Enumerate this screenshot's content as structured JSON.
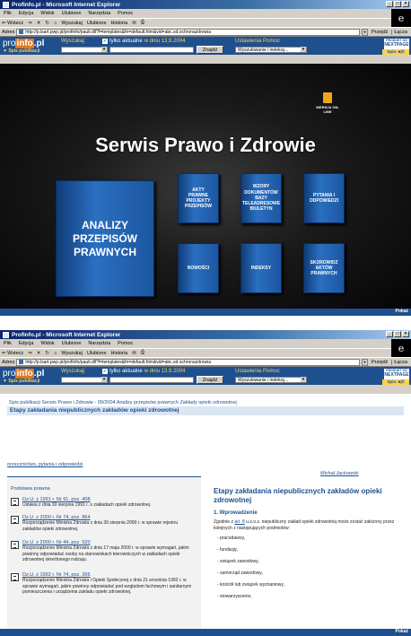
{
  "window": {
    "title": "Profinfo.pl - Microsoft Internet Explorer",
    "title2": "Profinfo.pl - Microsoft Internet Explorer",
    "controls": [
      "_",
      "□",
      "×"
    ]
  },
  "menu": [
    "Plik",
    "Edycja",
    "Widok",
    "Ulubione",
    "Narzędzia",
    "Pomoc"
  ],
  "toolbar": {
    "back": "⇐ Wstecz",
    "forward": "⇒",
    "stop": "✕",
    "refresh": "↻",
    "home": "⌂",
    "search": "Wyszukaj",
    "favorites": "Ulubione",
    "history": "Historia",
    "mail": "✉",
    "print": "⎙"
  },
  "address": {
    "label": "Adres",
    "url1": "http://p.lsart.pwp.pl/profinfo/pauti.dll?f=templates&fn=default.htm&vid=abc.sd.ochronazdrowia",
    "url2": "http://p.lsart.pwp.pl/profinfo/pauti.dll?f=templates&fn=default.htm&vid=abc.sd.ochronazdrowia",
    "go": "Przejdź",
    "links": "Łącza"
  },
  "site": {
    "logo_pro": "pro",
    "logo_info": "info",
    "logo_pl": ".pl",
    "search_label": "Wyszukaj:",
    "only_current": "tylko aktualne",
    "date_label": "w dniu 13.9.2004",
    "links": "Ustawienia  Pomoc",
    "select1": "",
    "search_btn": "Znajdź",
    "select2": "Wyszukiwanie i indeksy...",
    "spis_left": "▼ Spis publikacji",
    "brand_top": "PRODUKT OD",
    "brand_name": "NEXTPAGE",
    "spis_right": "Spis: ■|Ⅹ"
  },
  "screen1": {
    "wersja": "WERSJA ON-LINE",
    "main_title": "Serwis Prawo i Zdrowie",
    "big_book": "ANALIZY\nPRZEPISÓW\nPRAWNYCH",
    "books": [
      "AKTY\nPRAWNE\nPROJEKTY\nPRZEPISÓW",
      "WZORY\nDOKUMENTÓW\nBAZY\nTELEADRESOWE\nBIULETYN",
      "PYTANIA I\nODPOWIEDZI",
      "NOWOŚCI",
      "INDEKSY",
      "SKOROWIDZ\nAKTÓW\nPRAWNYCH"
    ],
    "status": "Pokaż"
  },
  "screen2": {
    "breadcrumb": "Spis publikacji  Serwis Prawo i Zdrowie - 09/2004  Analizy przepisów prawnych  Zakłady opieki zdrowotnej",
    "page_title": "Etapy zakładania niepublicznych zakładów opieki zdrowotnej",
    "sec_links": "orzecznictwo, pytania i odpowiedzi",
    "author": "Michał Jackowski",
    "left_header": "Podstawa prawna",
    "legal": [
      {
        "ref": "Dz.U. z 1991 r. Nr 91, poz. 408",
        "desc": "Ustawa z dnia 30 sierpnia 1991 r. o zakładach opieki zdrowotnej."
      },
      {
        "ref": "Dz.U. z 2000 r. Nr 74, poz. 864",
        "desc": "Rozporządzenie Ministra Zdrowia z dnia 30 sierpnia 2000 r. w sprawie rejestru zakładów opieki zdrowotnej."
      },
      {
        "ref": "Dz.U. z 2000 r. Nr 44, poz. 520",
        "desc": "Rozporządzenie Ministra Zdrowia z dnia 17 maja 2000 r. w sprawie wymagań, jakim powinny odpowiadać osoby na stanowiskach kierowniczych w zakładach opieki zdrowotnej określonego rodzaju."
      },
      {
        "ref": "Dz.U. z 1992 r. Nr 74, poz. 366",
        "desc": "Rozporządzenie Ministra Zdrowia i Opieki Społecznej z dnia 21 września 1992 r. w sprawie wymagań, jakim powinny odpowiadać pod względem fachowym i sanitarnym pomieszczenia i urządzenia zakładu opieki zdrowotnej."
      }
    ],
    "right_title": "Etapy zakładania niepublicznych zakładów opieki zdrowotnej",
    "right_section": "1. Wprowadzenie",
    "right_para_before": "Zgodnie z",
    "right_para_link": "art. 8",
    "right_para_after": "u.z.o.z. niepubliczny zakład opieki zdrowotnej może zostać założony przez kolejnych z następujących podmiotów:",
    "list": [
      "- pracodawcę,",
      "- fundację,",
      "- związek zawodowy,",
      "- samorząd zawodowy,",
      "- kościół lub związek wyznaniowy,",
      "- stowarzyszenie,"
    ],
    "status": "Pokaż"
  }
}
